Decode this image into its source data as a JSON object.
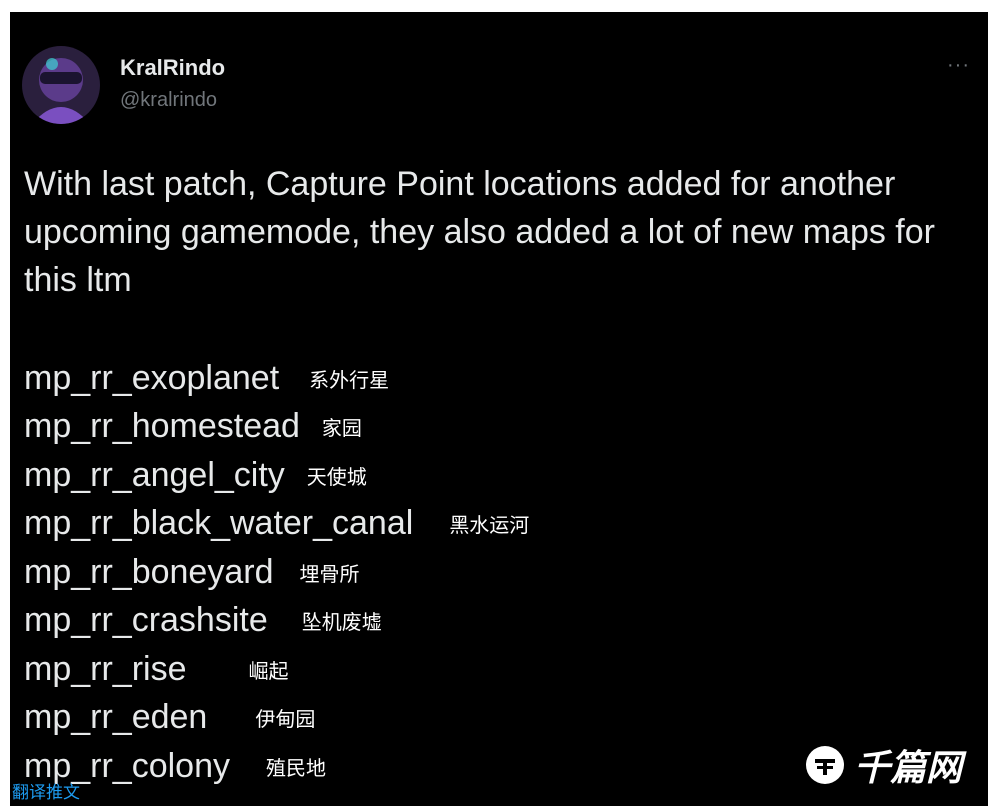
{
  "tweet": {
    "author_name": "KralRindo",
    "author_handle": "@kralrindo",
    "more_icon": "···",
    "text": "With last patch, Capture Point locations added for another upcoming gamemode, they also added a lot of new maps for this ltm",
    "maps": [
      {
        "id": "mp_rr_exoplanet",
        "cn": "系外行星"
      },
      {
        "id": "mp_rr_homestead",
        "cn": "家园"
      },
      {
        "id": "mp_rr_angel_city",
        "cn": "天使城"
      },
      {
        "id": "mp_rr_black_water_canal",
        "cn": "黑水运河"
      },
      {
        "id": "mp_rr_boneyard",
        "cn": "埋骨所"
      },
      {
        "id": "mp_rr_crashsite",
        "cn": "坠机废墟"
      },
      {
        "id": "mp_rr_rise",
        "cn": "崛起"
      },
      {
        "id": "mp_rr_eden",
        "cn": "伊甸园"
      },
      {
        "id": "mp_rr_colony",
        "cn": "殖民地"
      }
    ],
    "translate_label": "翻译推文"
  },
  "watermark": {
    "text": "千篇网",
    "icon": "qianpian-logo-icon"
  },
  "colors": {
    "background": "#000000",
    "text": "#e7e9ea",
    "secondary": "#71767b",
    "link": "#1d9bf0"
  }
}
